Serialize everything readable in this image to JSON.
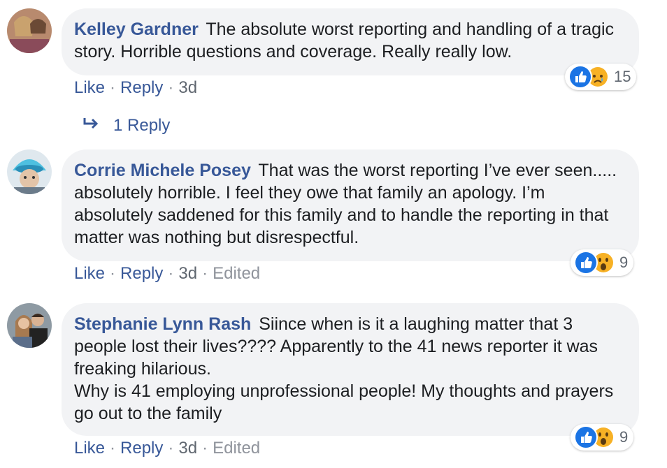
{
  "comments": [
    {
      "author": "Kelley Gardner",
      "text": "The absolute worst reporting and handling of a tragic story. Horrible questions and coverage. Really really low.",
      "actions": {
        "like": "Like",
        "reply": "Reply",
        "time": "3d"
      },
      "reactions": {
        "icons": [
          "like-icon",
          "sad-icon"
        ],
        "count": "15"
      }
    },
    {
      "author": "Corrie Michele Posey",
      "text": "That was the worst reporting I’ve ever seen..... absolutely horrible. I feel they owe that family an apology. I’m absolutely saddened for this family and to handle the reporting in that matter was nothing but disrespectful.",
      "actions": {
        "like": "Like",
        "reply": "Reply",
        "time": "3d",
        "edited": "Edited"
      },
      "reactions": {
        "icons": [
          "like-icon",
          "wow-icon"
        ],
        "count": "9"
      }
    },
    {
      "author": "Stephanie Lynn Rash",
      "text": "Siince when is it a laughing matter that 3 people lost their lives???? Apparently to the 41 news reporter it was freaking hilarious.\nWhy is 41 employing unprofessional people! My thoughts and prayers go out to the family",
      "actions": {
        "like": "Like",
        "reply": "Reply",
        "time": "3d",
        "edited": "Edited"
      },
      "reactions": {
        "icons": [
          "like-icon",
          "wow-icon"
        ],
        "count": "9"
      }
    }
  ],
  "replies_link": "1 Reply",
  "colors": {
    "link": "#385898",
    "meta": "#90949c",
    "bubble": "#f2f3f5",
    "like": "#1b74e4",
    "emoji": "#f7b125"
  }
}
